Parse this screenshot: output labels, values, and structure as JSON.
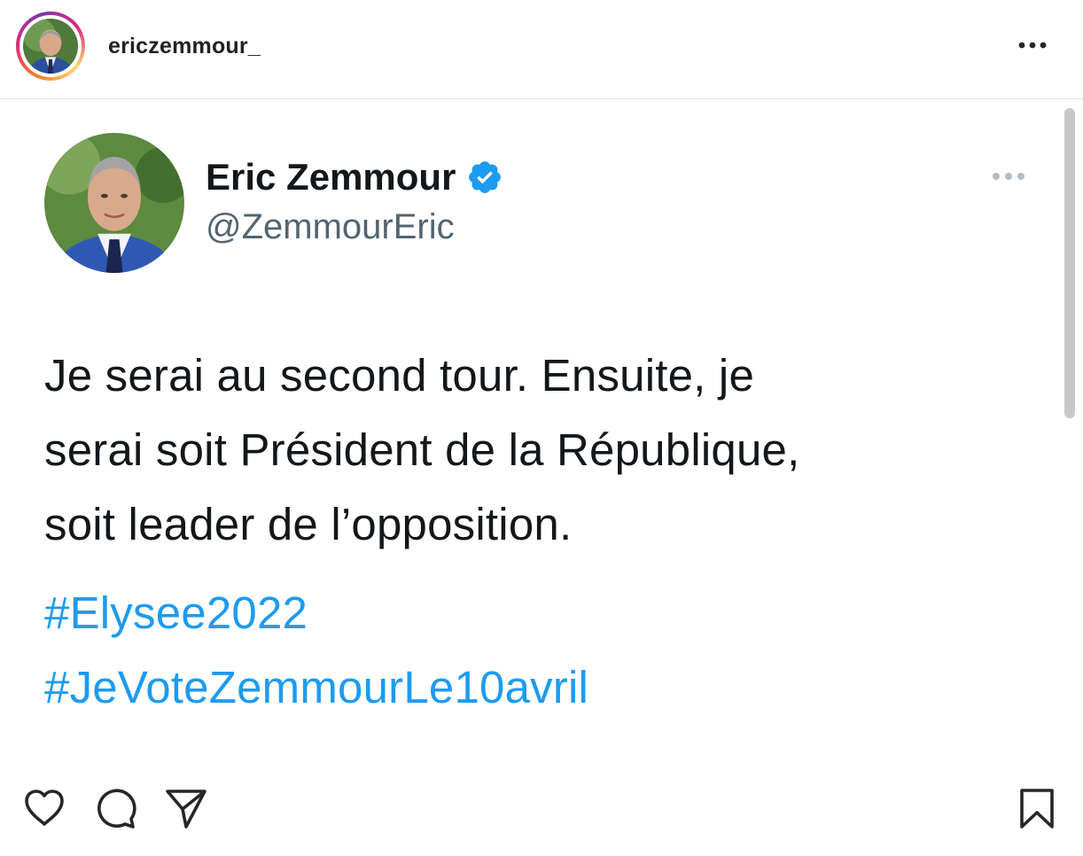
{
  "instagram": {
    "username": "ericzemmour_",
    "more_icon": "more-horizontal-icon"
  },
  "tweet": {
    "author_name": "Eric Zemmour",
    "verified_icon": "verified-badge-icon",
    "handle": "@ZemmourEric",
    "more_icon": "more-horizontal-icon",
    "text_lines": [
      "Je serai au second tour. Ensuite, je",
      "serai soit Président de la République,",
      "soit leader de l’opposition."
    ],
    "hashtags": [
      "#Elysee2022",
      "#JeVoteZemmourLe10avril"
    ]
  },
  "actions": {
    "like_icon": "heart-icon",
    "comment_icon": "comment-icon",
    "share_icon": "paper-plane-icon",
    "save_icon": "bookmark-icon"
  },
  "colors": {
    "hashtag": "#1d9bf0",
    "handle": "#536471",
    "verified": "#1d9bf0",
    "text": "#14171a"
  }
}
